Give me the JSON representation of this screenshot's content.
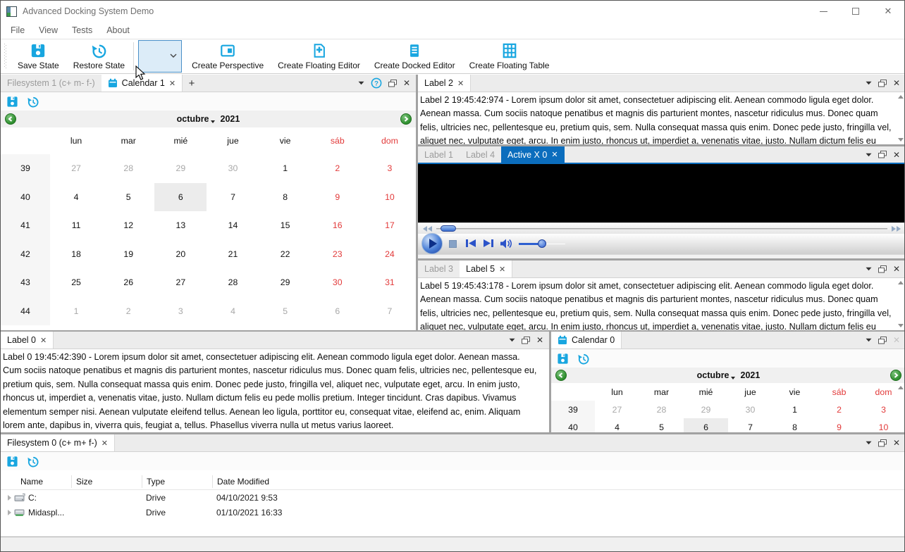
{
  "window": {
    "title": "Advanced Docking System Demo"
  },
  "menu": {
    "items": [
      "File",
      "View",
      "Tests",
      "About"
    ]
  },
  "toolbar": {
    "save_state": "Save State",
    "restore_state": "Restore State",
    "create_perspective": "Create Perspective",
    "create_floating_editor": "Create Floating Editor",
    "create_docked_editor": "Create Docked Editor",
    "create_floating_table": "Create Floating Table",
    "perspective_combo_value": ""
  },
  "colors": {
    "accent_cyan": "#18a6e0",
    "active_tab_blue": "#0b6dbd",
    "weekend_red": "#e23a3a",
    "nav_green": "#2f8f2f"
  },
  "calendar": {
    "month": "octubre",
    "year": "2021",
    "weekdays": [
      "lun",
      "mar",
      "mié",
      "jue",
      "vie",
      "sáb",
      "dom"
    ],
    "weeks": [
      {
        "num": "39",
        "days": [
          {
            "t": "27",
            "m": 1
          },
          {
            "t": "28",
            "m": 1
          },
          {
            "t": "29",
            "m": 1
          },
          {
            "t": "30",
            "m": 1
          },
          {
            "t": "1"
          },
          {
            "t": "2"
          },
          {
            "t": "3"
          }
        ]
      },
      {
        "num": "40",
        "days": [
          {
            "t": "4"
          },
          {
            "t": "5"
          },
          {
            "t": "6",
            "sel": 1
          },
          {
            "t": "7"
          },
          {
            "t": "8"
          },
          {
            "t": "9"
          },
          {
            "t": "10"
          }
        ]
      },
      {
        "num": "41",
        "days": [
          {
            "t": "11"
          },
          {
            "t": "12"
          },
          {
            "t": "13"
          },
          {
            "t": "14"
          },
          {
            "t": "15"
          },
          {
            "t": "16"
          },
          {
            "t": "17"
          }
        ]
      },
      {
        "num": "42",
        "days": [
          {
            "t": "18"
          },
          {
            "t": "19"
          },
          {
            "t": "20"
          },
          {
            "t": "21"
          },
          {
            "t": "22"
          },
          {
            "t": "23"
          },
          {
            "t": "24"
          }
        ]
      },
      {
        "num": "43",
        "days": [
          {
            "t": "25"
          },
          {
            "t": "26"
          },
          {
            "t": "27"
          },
          {
            "t": "28"
          },
          {
            "t": "29"
          },
          {
            "t": "30"
          },
          {
            "t": "31"
          }
        ]
      },
      {
        "num": "44",
        "days": [
          {
            "t": "1",
            "m": 1
          },
          {
            "t": "2",
            "m": 1
          },
          {
            "t": "3",
            "m": 1
          },
          {
            "t": "4",
            "m": 1
          },
          {
            "t": "5",
            "m": 1
          },
          {
            "t": "6",
            "m": 1
          },
          {
            "t": "7",
            "m": 1
          }
        ]
      }
    ]
  },
  "panels": {
    "leftdock": {
      "tabs": [
        "Filesystem 1 (c+ m- f-)",
        "Calendar 1"
      ],
      "new_tab": "+"
    },
    "label2": {
      "tab": "Label 2",
      "text": "Label 2 19:45:42:974 - Lorem ipsum dolor sit amet, consectetuer adipiscing elit. Aenean commodo ligula eget dolor. Aenean massa. Cum sociis natoque penatibus et magnis dis parturient montes, nascetur ridiculus mus. Donec quam felis, ultricies nec, pellentesque eu, pretium quis, sem. Nulla consequat massa quis enim. Donec pede justo, fringilla vel, aliquet nec, vulputate eget, arcu. In enim justo, rhoncus ut, imperdiet a, venenatis vitae, justo. Nullam dictum felis eu pede mollis pretium. Integer tincidunt. Cras dapibus. Vivamus elementum semper nisi. Aenean vulputate eleifend tellus. Aenean leo ligula, porttitor eu, consequat vitae, eleifend ac, enim. Aliquam"
    },
    "activex": {
      "tabs": [
        "Label 1",
        "Label 4",
        "Active X 0"
      ]
    },
    "label5": {
      "tabs": [
        "Label 3",
        "Label 5"
      ],
      "text": "Label 5 19:45:43:178 - Lorem ipsum dolor sit amet, consectetuer adipiscing elit. Aenean commodo ligula eget dolor. Aenean massa. Cum sociis natoque penatibus et magnis dis parturient montes, nascetur ridiculus mus. Donec quam felis, ultricies nec, pellentesque eu, pretium quis, sem. Nulla consequat massa quis enim. Donec pede justo, fringilla vel, aliquet nec, vulputate eget, arcu. In enim justo, rhoncus ut, imperdiet a, venenatis vitae, justo. Nullam dictum felis eu pede mollis pretium. Integer tincidunt. Cras dapibus. Vivamus elementum semper nisi. Aenean vulputate eleifend tellus. Aenean leo ligula, porttitor eu, consequat vitae, eleifend ac, enim. Aliquam"
    },
    "label0": {
      "tab": "Label 0",
      "text": "Label 0 19:45:42:390 - Lorem ipsum dolor sit amet, consectetuer adipiscing elit. Aenean commodo ligula eget dolor. Aenean massa. Cum sociis natoque penatibus et magnis dis parturient montes, nascetur ridiculus mus. Donec quam felis, ultricies nec, pellentesque eu, pretium quis, sem. Nulla consequat massa quis enim. Donec pede justo, fringilla vel, aliquet nec, vulputate eget, arcu. In enim justo, rhoncus ut, imperdiet a, venenatis vitae, justo. Nullam dictum felis eu pede mollis pretium. Integer tincidunt. Cras dapibus. Vivamus elementum semper nisi. Aenean vulputate eleifend tellus. Aenean leo ligula, porttitor eu, consequat vitae, eleifend ac, enim. Aliquam lorem ante, dapibus in, viverra quis, feugiat a, tellus. Phasellus viverra nulla ut metus varius laoreet."
    },
    "calendar0": {
      "tab": "Calendar 0"
    },
    "filesystem0": {
      "tab": "Filesystem 0 (c+ m+ f-)",
      "columns": [
        "Name",
        "Size",
        "Type",
        "Date Modified"
      ],
      "rows": [
        {
          "name": "C:",
          "size": "",
          "type": "Drive",
          "date": "04/10/2021 9:53",
          "icon": "drive-icon"
        },
        {
          "name": "Midaspl...",
          "size": "",
          "type": "Drive",
          "date": "01/10/2021 16:33",
          "icon": "network-drive-icon"
        }
      ]
    }
  }
}
